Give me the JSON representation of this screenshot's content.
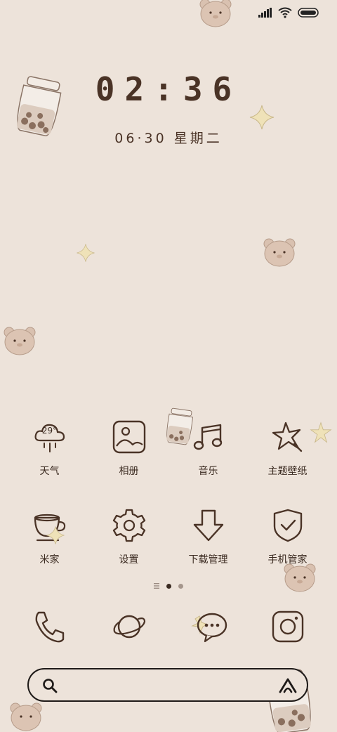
{
  "clock": {
    "time": "02:36",
    "date": "06·30 星期二"
  },
  "apps": [
    {
      "label": "天气",
      "icon": "weather-cloud-icon",
      "temp": "29°"
    },
    {
      "label": "相册",
      "icon": "gallery-icon"
    },
    {
      "label": "音乐",
      "icon": "music-note-icon"
    },
    {
      "label": "主题壁纸",
      "icon": "star-icon"
    },
    {
      "label": "米家",
      "icon": "cup-icon"
    },
    {
      "label": "设置",
      "icon": "gear-icon"
    },
    {
      "label": "下载管理",
      "icon": "download-arrow-icon"
    },
    {
      "label": "手机管家",
      "icon": "shield-icon"
    }
  ],
  "dock": [
    {
      "icon": "phone-icon"
    },
    {
      "icon": "planet-icon"
    },
    {
      "icon": "message-bubble-icon"
    },
    {
      "icon": "camera-icon"
    }
  ],
  "colors": {
    "background": "#ede3da",
    "ink": "#4a3326",
    "star": "#efe2b8",
    "bear": "#d9c1b0"
  }
}
